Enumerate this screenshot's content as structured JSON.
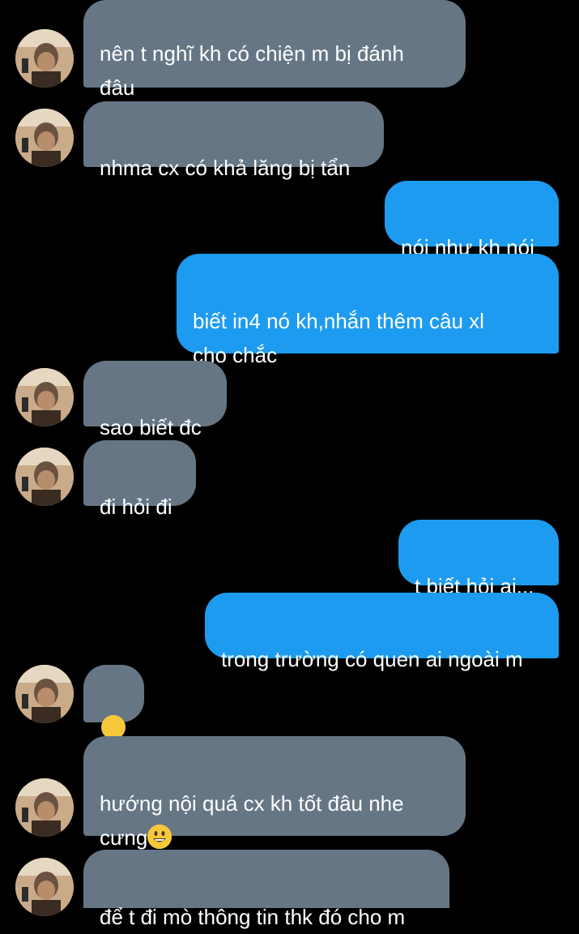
{
  "messages": [
    {
      "side": "in",
      "text": "nên t nghĩ kh có chiện m bị đánh\nđâu",
      "avatar": true
    },
    {
      "side": "in",
      "text": "nhma cx có khả lăng bị tẩn",
      "avatar": true
    },
    {
      "side": "out",
      "text": "nói như kh nói"
    },
    {
      "side": "out",
      "text": "biết in4 nó kh,nhắn thêm câu xl\ncho chắc"
    },
    {
      "side": "in",
      "text": "sao biết đc",
      "avatar": true
    },
    {
      "side": "in",
      "text": "đi hỏi đi",
      "avatar": true
    },
    {
      "side": "out",
      "text": "t biết hỏi ai..."
    },
    {
      "side": "out",
      "text": "trong trường có quen ai ngoài m"
    },
    {
      "side": "in",
      "text": "",
      "emoji": "nerd-face-emoji",
      "avatar": true
    },
    {
      "side": "in",
      "text": "hướng nội quá cx kh tốt đâu nhe\ncưng",
      "emoji_after": "grinning-face-emoji",
      "avatar": true
    },
    {
      "side": "in",
      "text": "để t đi mò thông tin thk đó cho m",
      "avatar": true
    }
  ],
  "colors": {
    "background": "#000000",
    "incoming_bubble": "#667685",
    "outgoing_bubble": "#1d9bf0",
    "text": "#ffffff"
  }
}
